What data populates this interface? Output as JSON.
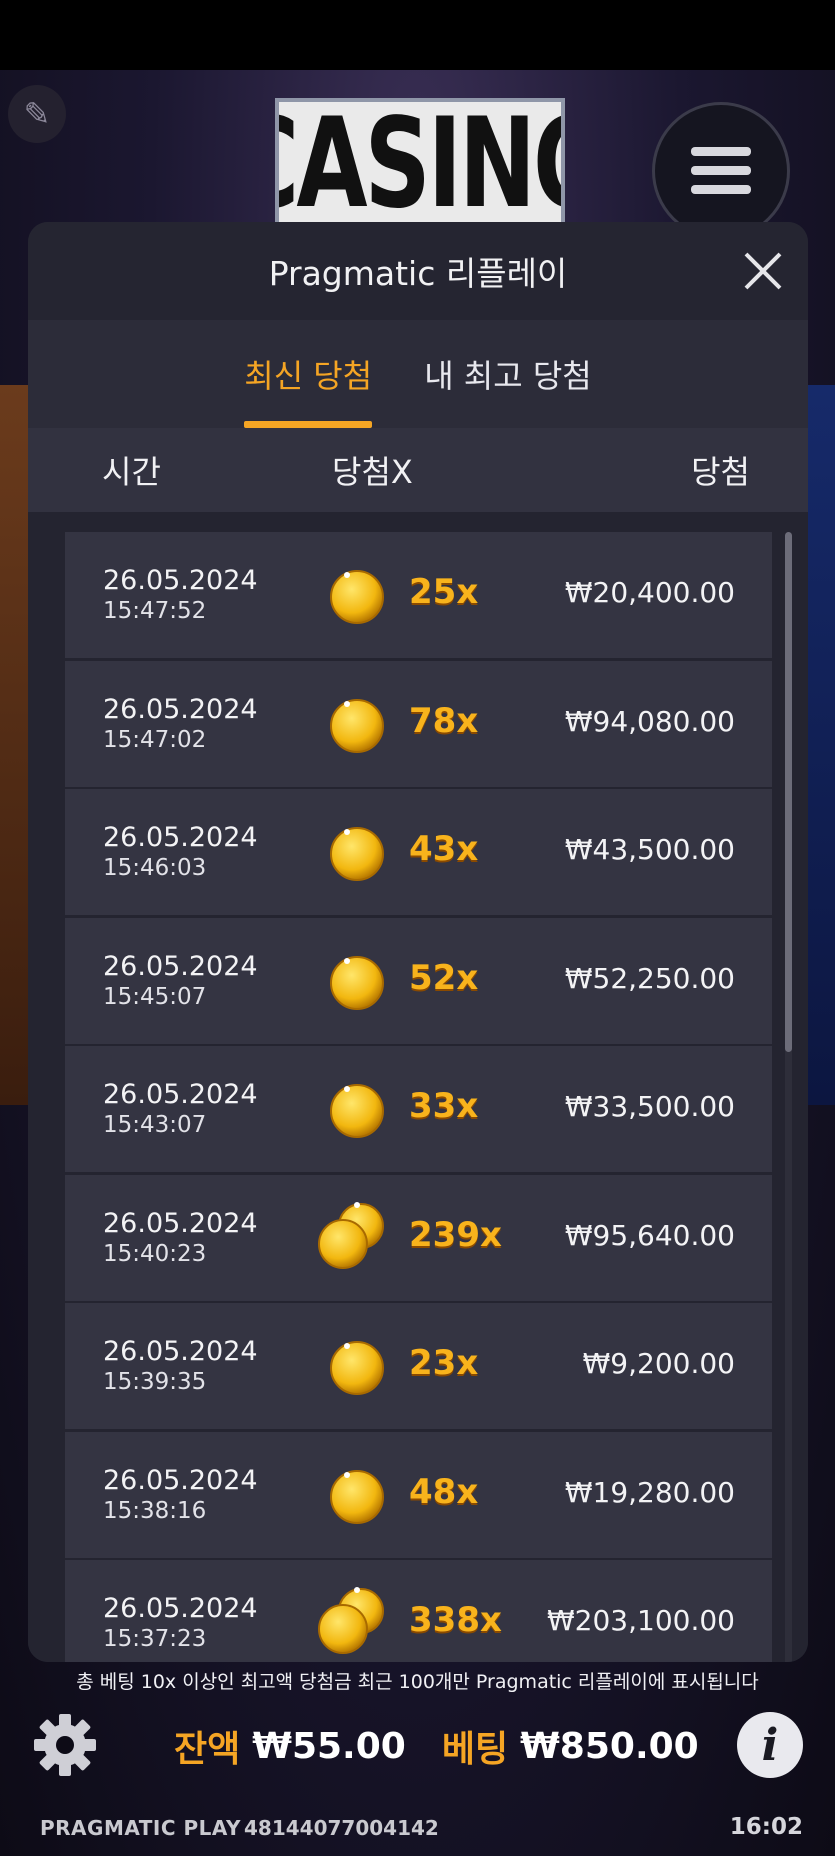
{
  "logo": {
    "text": "CASINO"
  },
  "icons": {
    "pencil": "pencil-icon",
    "menu": "hamburger-menu-icon",
    "close": "close-icon",
    "coin": "gold-coin-icon",
    "coins": "gold-coins-stack-icon",
    "settings": "gear-icon",
    "info": "info-icon"
  },
  "modal": {
    "title": "Pragmatic 리플레이",
    "tabs": [
      {
        "label": "최신 당첨",
        "active": true
      },
      {
        "label": "내 최고 당첨",
        "active": false
      }
    ],
    "columns": {
      "time": "시간",
      "multiplier": "당첨X",
      "win": "당첨"
    },
    "rows": [
      {
        "date": "26.05.2024",
        "time": "15:47:52",
        "mult": "25x",
        "amount": "₩20,400.00",
        "coins": 1
      },
      {
        "date": "26.05.2024",
        "time": "15:47:02",
        "mult": "78x",
        "amount": "₩94,080.00",
        "coins": 1
      },
      {
        "date": "26.05.2024",
        "time": "15:46:03",
        "mult": "43x",
        "amount": "₩43,500.00",
        "coins": 1
      },
      {
        "date": "26.05.2024",
        "time": "15:45:07",
        "mult": "52x",
        "amount": "₩52,250.00",
        "coins": 1
      },
      {
        "date": "26.05.2024",
        "time": "15:43:07",
        "mult": "33x",
        "amount": "₩33,500.00",
        "coins": 1
      },
      {
        "date": "26.05.2024",
        "time": "15:40:23",
        "mult": "239x",
        "amount": "₩95,640.00",
        "coins": 2
      },
      {
        "date": "26.05.2024",
        "time": "15:39:35",
        "mult": "23x",
        "amount": "₩9,200.00",
        "coins": 1
      },
      {
        "date": "26.05.2024",
        "time": "15:38:16",
        "mult": "48x",
        "amount": "₩19,280.00",
        "coins": 1
      },
      {
        "date": "26.05.2024",
        "time": "15:37:23",
        "mult": "338x",
        "amount": "₩203,100.00",
        "coins": 2
      }
    ]
  },
  "footnote": "총 베팅 10x 이상인 최고액 당첨금 최근 100개만 Pragmatic 리플레이에 표시됩니다",
  "bottom": {
    "balance_label": "잔액",
    "balance_value": "₩55.00",
    "bet_label": "베팅",
    "bet_value": "₩850.00"
  },
  "status": {
    "brand": "PRAGMATIC PLAY",
    "session_id": "48144077004142",
    "clock": "16:02"
  },
  "colors": {
    "accent": "#f5a524",
    "modal_bg": "#2a2a37",
    "row_bg": "#343442"
  }
}
